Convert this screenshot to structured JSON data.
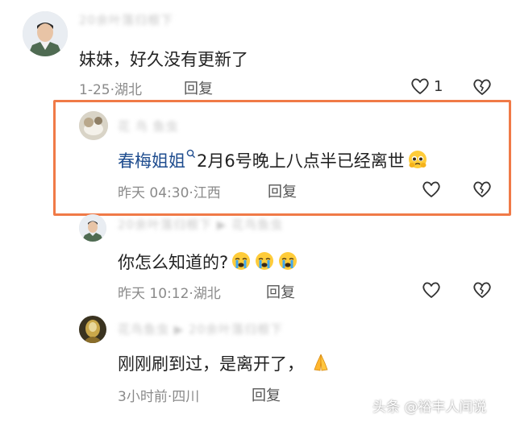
{
  "comments": [
    {
      "name_hidden": "20余叶落归根下",
      "text": "妹妹，好久没有更新了",
      "date": "1-25",
      "location": "湖北",
      "reply_label": "回复",
      "like_count": "1"
    },
    {
      "name_hidden": "花 鸟 鱼虫",
      "mention": "春梅姐姐",
      "text": "2月6号晚上八点半已经离世",
      "date": "昨天 04:30",
      "location": "江西",
      "reply_label": "回复"
    },
    {
      "name_hidden": "20余叶落归根下 ▶ 花鸟鱼虫",
      "text": "你怎么知道的?",
      "date": "昨天 10:12",
      "location": "湖北",
      "reply_label": "回复"
    },
    {
      "name_hidden": "花鸟鱼虫 ▶ 20余叶落归根下",
      "text": "刚刚刷到过，是离开了，",
      "date": "3小时前",
      "location": "四川",
      "reply_label": "回复"
    }
  ],
  "sep": "·",
  "watermark": "头条 @裕丰人间说",
  "colors": {
    "highlight": "#f07a47",
    "mention": "#1f4d8f",
    "meta": "#8a8a8a"
  }
}
